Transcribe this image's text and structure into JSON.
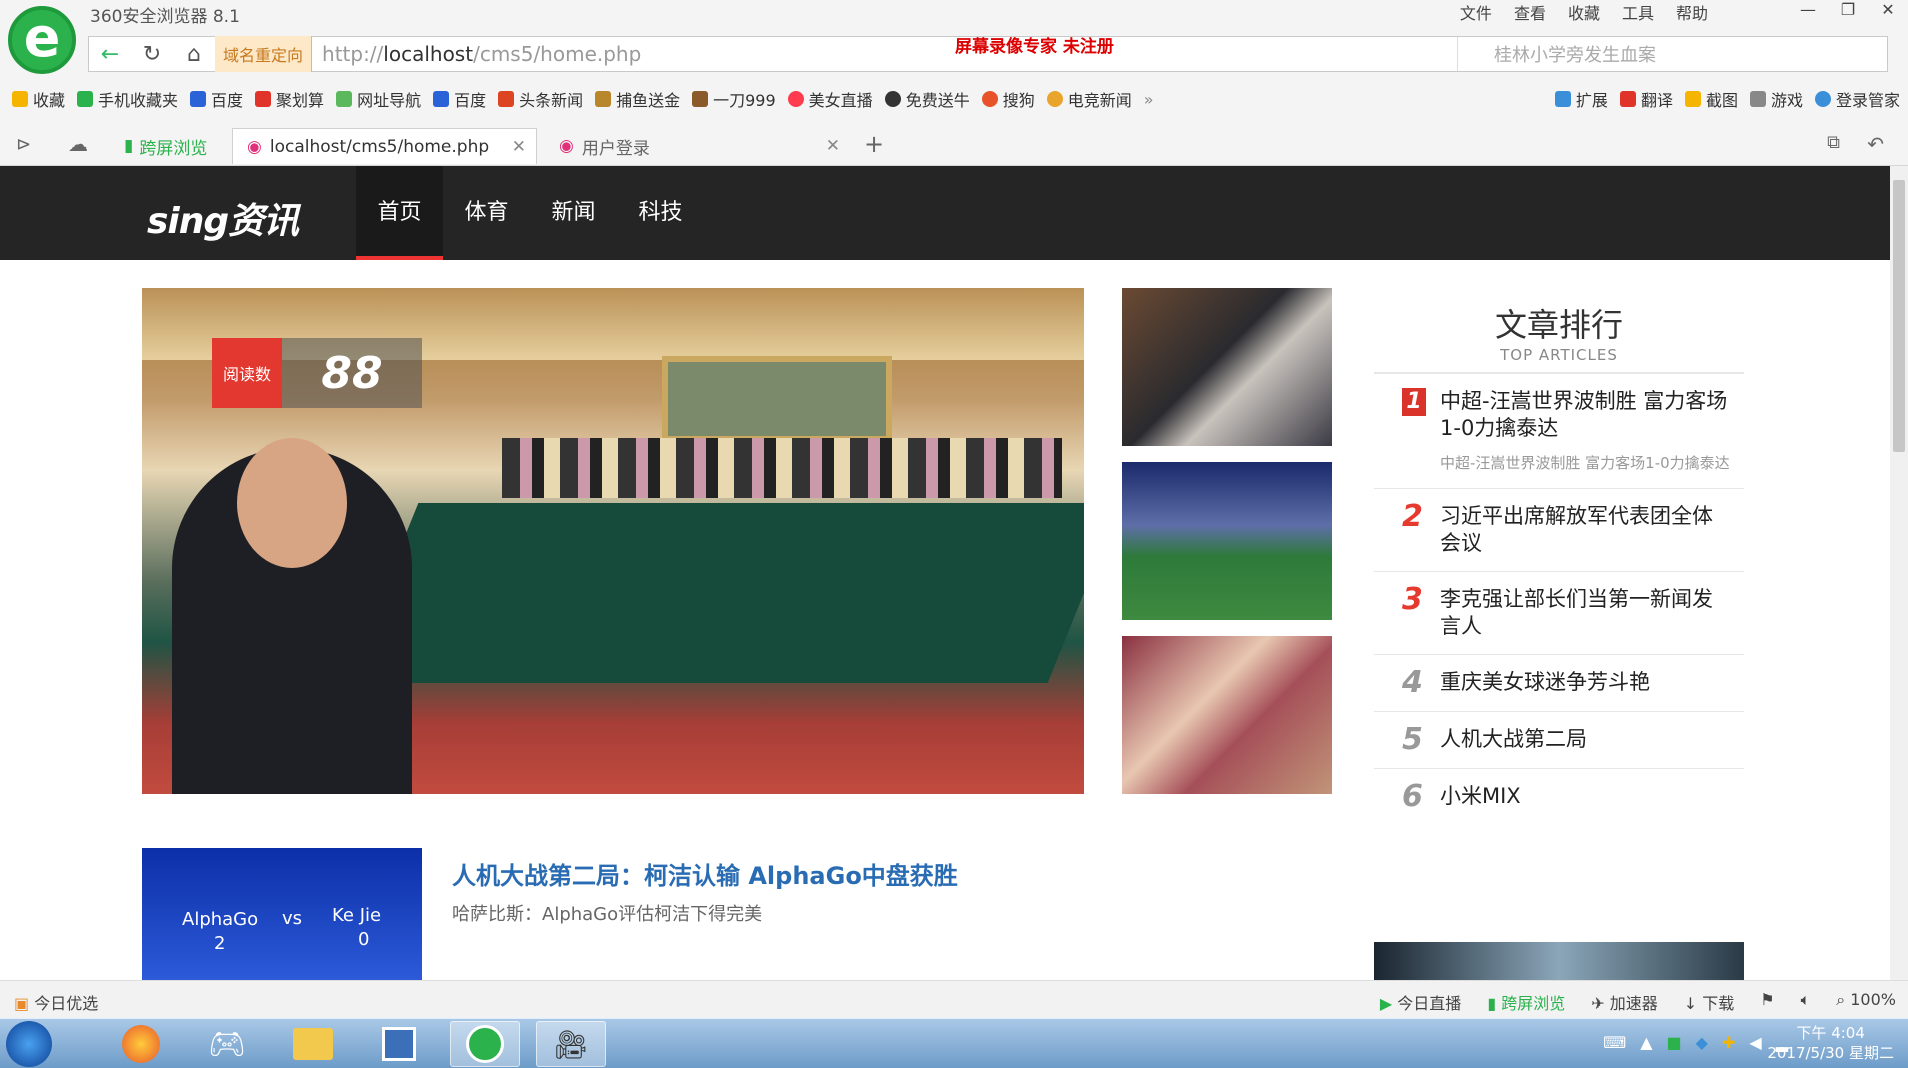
{
  "browser": {
    "title": "360安全浏览器 8.1",
    "menu": [
      "文件",
      "查看",
      "收藏",
      "工具",
      "帮助"
    ],
    "redirect_label": "域名重定向",
    "url_prefix": "http://",
    "url_host": "localhost",
    "url_path": "/cms5/home.php",
    "watermark": "屏幕录像专家  未注册",
    "search_placeholder": "桂林小学旁发生血案",
    "bookmarks": [
      "收藏",
      "手机收藏夹",
      "百度",
      "聚划算",
      "网址导航",
      "百度",
      "头条新闻",
      "捕鱼送金",
      "一刀999",
      "美女直播",
      "免费送牛",
      "搜狗",
      "电竞新闻"
    ],
    "bookmarks_right": [
      "扩展",
      "翻译",
      "截图",
      "游戏",
      "登录管家"
    ],
    "tabs": {
      "t0": "跨屏浏览",
      "t1": "localhost/cms5/home.php",
      "t2": "用户登录"
    }
  },
  "site": {
    "brand": "sing资讯",
    "nav": [
      "首页",
      "体育",
      "新闻",
      "科技"
    ],
    "hero": {
      "read_label": "阅读数",
      "read_count": "88"
    },
    "side": {
      "title": "文章排行",
      "subtitle": "TOP ARTICLES",
      "items": [
        {
          "num": "1",
          "title": "中超-汪嵩世界波制胜 富力客场1-0力擒泰达",
          "sub": "中超-汪嵩世界波制胜 富力客场1-0力擒泰达"
        },
        {
          "num": "2",
          "title": "习近平出席解放军代表团全体会议"
        },
        {
          "num": "3",
          "title": "李克强让部长们当第一新闻发言人"
        },
        {
          "num": "4",
          "title": "重庆美女球迷争芳斗艳"
        },
        {
          "num": "5",
          "title": "人机大战第二局"
        },
        {
          "num": "6",
          "title": "小米MIX"
        }
      ]
    },
    "feature": {
      "title": "人机大战第二局：柯洁认输 AlphaGo中盘获胜",
      "sub": "哈萨比斯：AlphaGo评估柯洁下得完美",
      "img_left": "AlphaGo",
      "img_left_score": "2",
      "img_vs": "vs",
      "img_right": "Ke Jie",
      "img_right_score": "0"
    }
  },
  "statusbar": {
    "left": "今日优选",
    "right": [
      "今日直播",
      "跨屏浏览",
      "加速器",
      "下载",
      "100%"
    ]
  },
  "taskbar": {
    "time": "下午 4:04",
    "date": "2017/5/30 星期二"
  }
}
